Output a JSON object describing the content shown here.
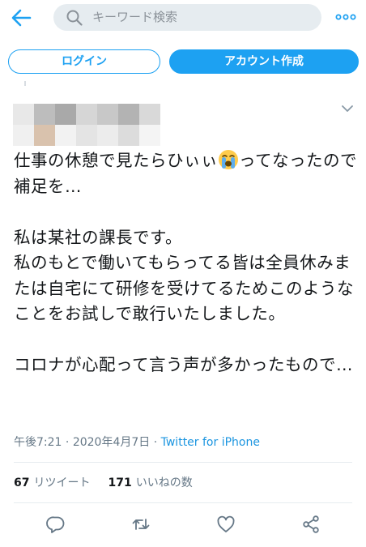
{
  "search": {
    "placeholder": "キーワード検索"
  },
  "auth": {
    "login_label": "ログイン",
    "signup_label": "アカウント作成"
  },
  "tweet": {
    "line1_before": "仕事の休憩で見たらひぃぃ",
    "line1_emoji": "loudly-crying-face",
    "line1_after": "ってなったので補足を…",
    "body": "\n\n私は某社の課長です。\n私のもとで働いてもらってる皆は全員休みまたは自宅にて研修を受けてるためこのようなことをお試しで敢行いたしました。\n\nコロナが心配って言う声が多かったもので…"
  },
  "meta": {
    "time": "午後7:21",
    "sep": " · ",
    "date": "2020年4月7日",
    "sep2": " · ",
    "source": "Twitter for iPhone"
  },
  "stats": {
    "retweets": "67",
    "retweets_label": "リツイート",
    "likes": "171",
    "likes_label": "いいねの数"
  },
  "icons": {
    "back": "back-arrow-icon",
    "search": "search-icon",
    "more": "more-icon",
    "caret": "chevron-down-icon",
    "reply": "reply-icon",
    "retweet": "retweet-icon",
    "like": "like-icon",
    "share": "share-icon"
  },
  "colors": {
    "accent": "#1da1f2",
    "link": "#1b95e0",
    "muted": "#657786",
    "search_bg": "#e6ecf0"
  }
}
